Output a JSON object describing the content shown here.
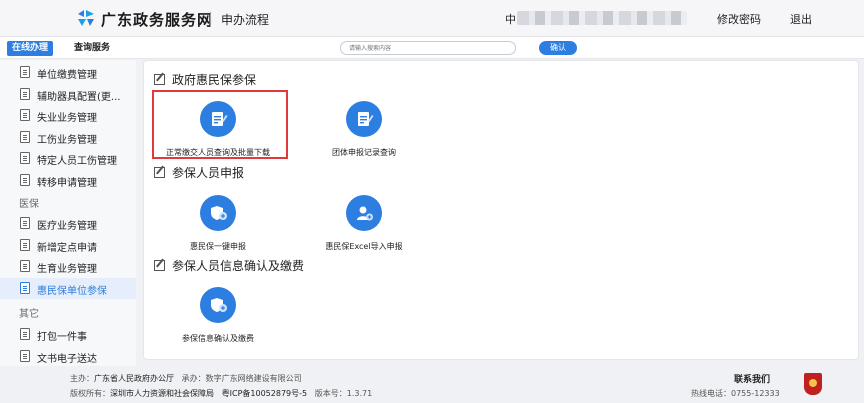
{
  "header": {
    "site_title": "广东政务服务网",
    "page_title": "申办流程",
    "user_prefix": "中",
    "change_password": "修改密码",
    "logout": "退出"
  },
  "toolbar": {
    "tab_online": "在线办理",
    "tab_query": "查询服务",
    "search_placeholder": "请输入搜索内容",
    "search_button": "确认"
  },
  "sidebar": {
    "items": [
      {
        "label": "单位缴费管理"
      },
      {
        "label": "辅助器具配置(更..."
      },
      {
        "label": "失业业务管理"
      },
      {
        "label": "工伤业务管理"
      },
      {
        "label": "特定人员工伤管理"
      },
      {
        "label": "转移申请管理"
      },
      {
        "label": "医保"
      },
      {
        "label": "医疗业务管理"
      },
      {
        "label": "新增定点申请"
      },
      {
        "label": "生育业务管理"
      },
      {
        "label": "惠民保单位参保"
      },
      {
        "label": "其它"
      },
      {
        "label": "打包一件事"
      },
      {
        "label": "文书电子送达"
      }
    ]
  },
  "main": {
    "sections": [
      {
        "title": "政府惠民保参保",
        "cards": [
          {
            "label": "正常缴交人员查询及批量下载",
            "icon": "edit-document-icon"
          },
          {
            "label": "团体申报记录查询",
            "icon": "edit-document-icon"
          }
        ]
      },
      {
        "title": "参保人员申报",
        "cards": [
          {
            "label": "惠民保一键申报",
            "icon": "shield-plus-icon"
          },
          {
            "label": "惠民保Excel导入申报",
            "icon": "user-plus-icon"
          }
        ]
      },
      {
        "title": "参保人员信息确认及缴费",
        "cards": [
          {
            "label": "参保信息确认及缴费",
            "icon": "shield-plus-icon"
          }
        ]
      }
    ]
  },
  "footer": {
    "host_label": "主办：",
    "host": "广东省人民政府办公厅",
    "operator_label": "承办：",
    "operator": "数字广东网络建设有限公司",
    "copyright_label": "版权所有：",
    "copyright": "深圳市人力资源和社会保障局",
    "icp": "粤ICP备10052879号-5",
    "version_label": "版本号：",
    "version": "1.3.71",
    "contact": "联系我们",
    "hotline_label": "热线电话：",
    "hotline": "0755-12333"
  },
  "colors": {
    "primary": "#2c7ee0",
    "highlight": "#e23a3a",
    "background": "#f0f1f4"
  }
}
